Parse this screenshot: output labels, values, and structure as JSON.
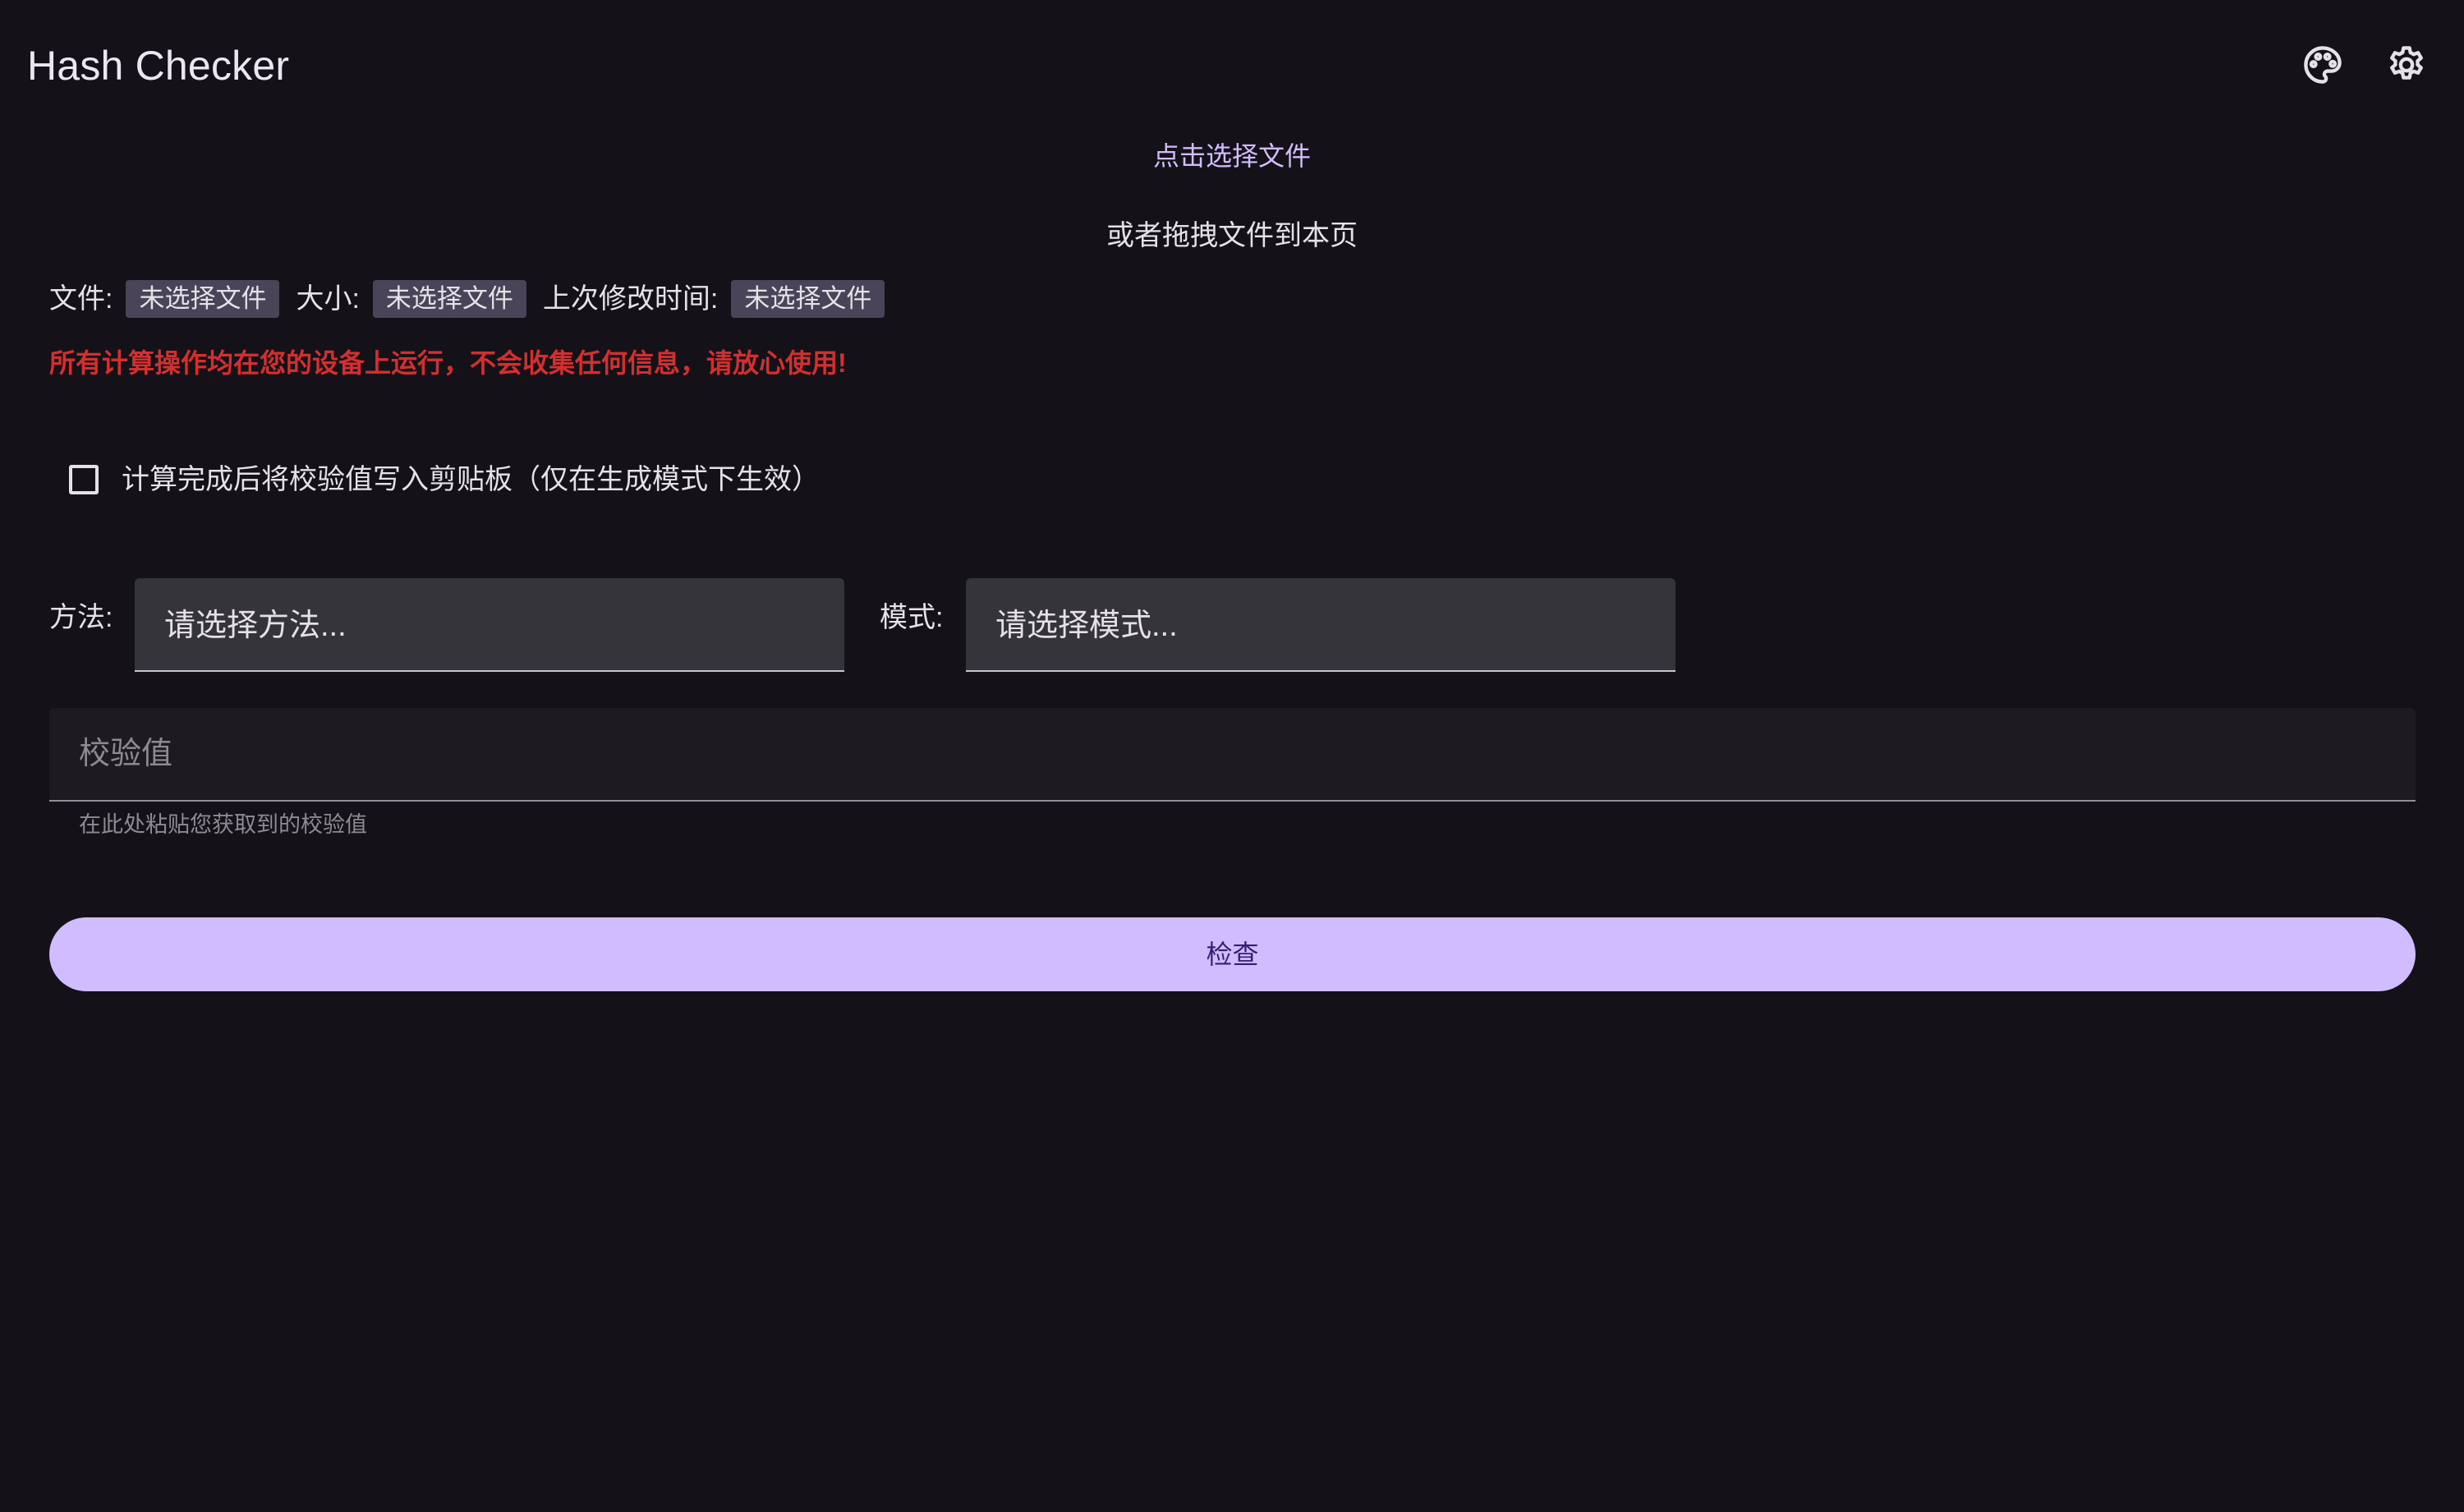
{
  "app": {
    "title": "Hash Checker"
  },
  "toolbar": {
    "icons": [
      "palette-icon",
      "gear-icon"
    ]
  },
  "file_picker": {
    "link_text": "点击选择文件",
    "drag_hint": "或者拖拽文件到本页"
  },
  "file_info": {
    "file_label": "文件:",
    "file_value": "未选择文件",
    "size_label": "大小:",
    "size_value": "未选择文件",
    "modified_label": "上次修改时间:",
    "modified_value": "未选择文件"
  },
  "privacy_notice": "所有计算操作均在您的设备上运行，不会收集任何信息，请放心使用!",
  "clipboard_option": {
    "label": "计算完成后将校验值写入剪贴板（仅在生成模式下生效）",
    "checked": false
  },
  "method": {
    "label": "方法:",
    "placeholder": "请选择方法..."
  },
  "mode": {
    "label": "模式:",
    "placeholder": "请选择模式..."
  },
  "hash_input": {
    "placeholder": "校验值",
    "value": "",
    "supporting_text": "在此处粘贴您获取到的校验值"
  },
  "check_button": {
    "label": "检查"
  },
  "colors": {
    "background": "#141218",
    "accent": "#d0bcff",
    "warning": "#d32f2f",
    "chip": "#4a4458",
    "field": "#36343b"
  }
}
